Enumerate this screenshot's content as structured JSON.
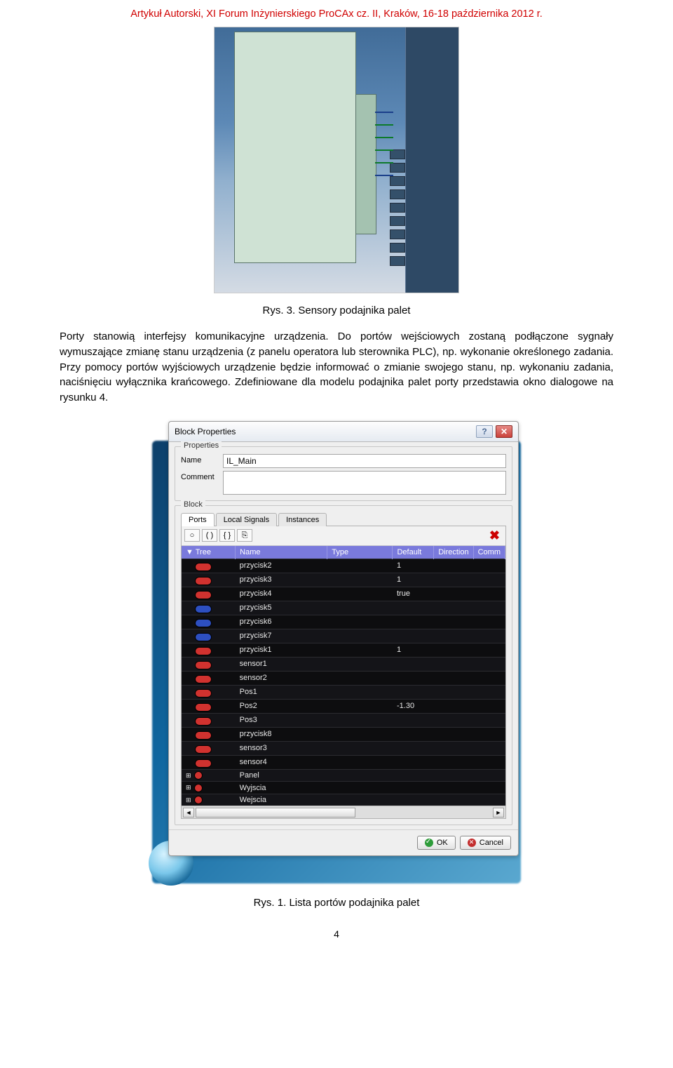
{
  "header_note": "Artykuł Autorski, XI Forum Inżynierskiego ProCAx cz. II, Kraków, 16-18 października 2012 r.",
  "fig3_caption": "Rys. 3. Sensory podajnika palet",
  "body_paragraph": "Porty stanowią interfejsy komunikacyjne urządzenia. Do portów wejściowych zostaną podłączone sygnały wymuszające zmianę stanu urządzenia (z panelu operatora lub sterownika PLC), np. wykonanie określonego zadania. Przy pomocy portów wyjściowych urządzenie będzie informować o zmianie swojego stanu, np. wykonaniu zadania, naciśnięciu wyłącznika krańcowego. Zdefiniowane dla modelu podajnika palet porty przedstawia okno dialogowe na rysunku 4.",
  "dialog": {
    "title": "Block Properties",
    "properties_group": "Properties",
    "name_label": "Name",
    "name_value": "IL_Main",
    "comment_label": "Comment",
    "comment_value": "",
    "block_group": "Block",
    "tabs": {
      "ports": "Ports",
      "local_signals": "Local Signals",
      "instances": "Instances"
    },
    "toolbar_buttons": [
      "○",
      "( )",
      "{ }",
      "⎘"
    ],
    "columns": [
      "Tree",
      "Name",
      "Type",
      "Default",
      "Direction",
      "Comm"
    ],
    "rows": [
      {
        "pin": "red",
        "name": "przycisk2",
        "type": "",
        "default": "1",
        "expand": false
      },
      {
        "pin": "red",
        "name": "przycisk3",
        "type": "",
        "default": "1",
        "expand": false
      },
      {
        "pin": "red",
        "name": "przycisk4",
        "type": "",
        "default": "true",
        "expand": false
      },
      {
        "pin": "blue",
        "name": "przycisk5",
        "type": "",
        "default": "",
        "expand": false
      },
      {
        "pin": "blue",
        "name": "przycisk6",
        "type": "",
        "default": "",
        "expand": false
      },
      {
        "pin": "blue",
        "name": "przycisk7",
        "type": "",
        "default": "",
        "expand": false
      },
      {
        "pin": "red",
        "name": "przycisk1",
        "type": "",
        "default": "1",
        "expand": false
      },
      {
        "pin": "red",
        "name": "sensor1",
        "type": "",
        "default": "",
        "expand": false
      },
      {
        "pin": "red",
        "name": "sensor2",
        "type": "",
        "default": "",
        "expand": false
      },
      {
        "pin": "red",
        "name": "Pos1",
        "type": "",
        "default": "",
        "expand": false
      },
      {
        "pin": "red",
        "name": "Pos2",
        "type": "",
        "default": "-1.30",
        "expand": false
      },
      {
        "pin": "red",
        "name": "Pos3",
        "type": "",
        "default": "",
        "expand": false
      },
      {
        "pin": "red",
        "name": "przycisk8",
        "type": "",
        "default": "",
        "expand": false
      },
      {
        "pin": "red",
        "name": "sensor3",
        "type": "",
        "default": "",
        "expand": false
      },
      {
        "pin": "red",
        "name": "sensor4",
        "type": "",
        "default": "",
        "expand": false
      },
      {
        "pin": "dot",
        "name": "Panel",
        "type": "",
        "default": "",
        "expand": true
      },
      {
        "pin": "dot",
        "name": "Wyjscia",
        "type": "",
        "default": "",
        "expand": true
      },
      {
        "pin": "dot",
        "name": "Wejscia",
        "type": "",
        "default": "",
        "expand": true
      }
    ],
    "ok_label": "OK",
    "cancel_label": "Cancel"
  },
  "fig1_caption": "Rys. 1. Lista portów podajnika palet",
  "page_number": "4"
}
